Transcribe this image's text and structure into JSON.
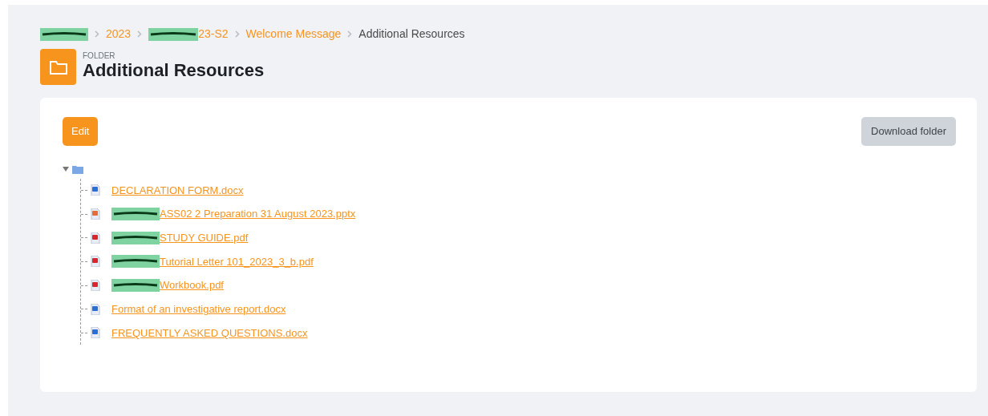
{
  "breadcrumb": [
    {
      "redacted": true
    },
    {
      "text": "2023",
      "redacted": false
    },
    {
      "text": "23-S2",
      "redacted": true
    },
    {
      "text": "Welcome Message",
      "redacted": false
    },
    {
      "text": "Additional Resources",
      "redacted": false,
      "current": true
    }
  ],
  "header": {
    "kicker": "FOLDER",
    "title": "Additional Resources"
  },
  "buttons": {
    "edit": "Edit",
    "download": "Download folder"
  },
  "tree": {
    "expanded": true,
    "files": [
      {
        "name": "DECLARATION FORM.docx",
        "kind": "docx",
        "redacted": false
      },
      {
        "name": "ASS02 2 Preparation 31 August 2023.pptx",
        "kind": "pptx",
        "redacted": true
      },
      {
        "name": "STUDY GUIDE.pdf",
        "kind": "pdf",
        "redacted": true
      },
      {
        "name": "Tutorial Letter 101_2023_3_b.pdf",
        "kind": "pdf",
        "redacted": true
      },
      {
        "name": "Workbook.pdf",
        "kind": "pdf",
        "redacted": true
      },
      {
        "name": "Format of an investigative report.docx",
        "kind": "docx",
        "redacted": false
      },
      {
        "name": "FREQUENTLY ASKED QUESTIONS.docx",
        "kind": "docx",
        "redacted": false
      }
    ]
  }
}
